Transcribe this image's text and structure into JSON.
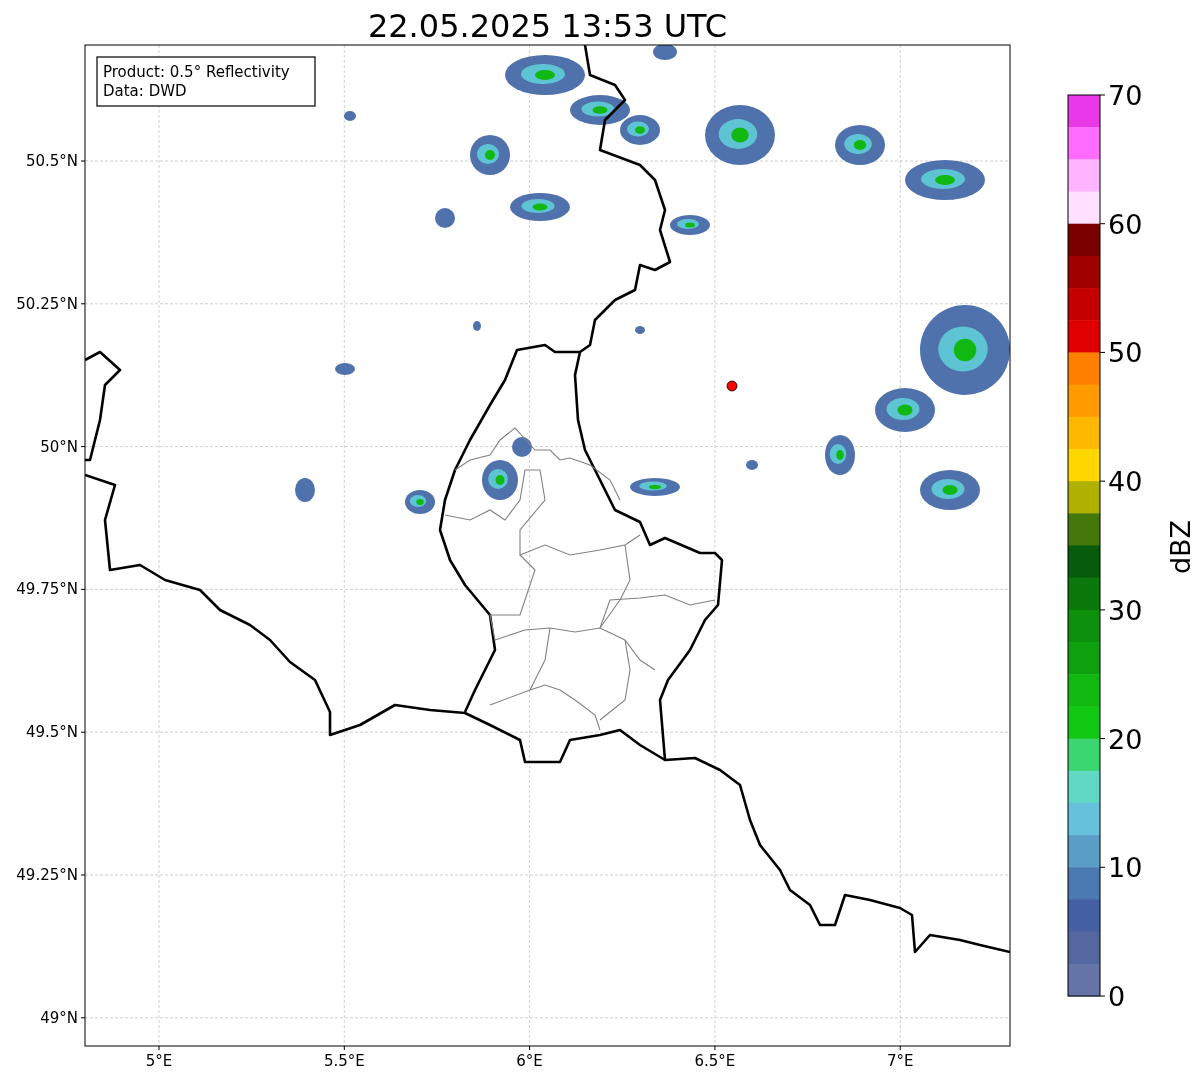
{
  "title": "22.05.2025 13:53 UTC",
  "map": {
    "info_lines": [
      "Product: 0.5° Reflectivity",
      "Data: DWD"
    ],
    "lat_ticks": [
      "50.5°N",
      "50.25°N",
      "50°N",
      "49.75°N",
      "49.5°N",
      "49.25°N",
      "49°N"
    ],
    "lon_ticks": [
      "5°E",
      "5.5°E",
      "6°E",
      "6.5°E",
      "7°E"
    ]
  },
  "colorbar": {
    "label": "dBZ",
    "ticks": [
      "70",
      "60",
      "50",
      "40",
      "30",
      "20",
      "10",
      "0"
    ],
    "bands": [
      {
        "color": "#e838e8"
      },
      {
        "color": "#ff6cff"
      },
      {
        "color": "#ffb4ff"
      },
      {
        "color": "#ffe0ff"
      },
      {
        "color": "#7a0000"
      },
      {
        "color": "#a00000"
      },
      {
        "color": "#c40000"
      },
      {
        "color": "#e00000"
      },
      {
        "color": "#ff7f00"
      },
      {
        "color": "#ff9a00"
      },
      {
        "color": "#ffb800"
      },
      {
        "color": "#ffd700"
      },
      {
        "color": "#b0b000"
      },
      {
        "color": "#44780a"
      },
      {
        "color": "#065c0a"
      },
      {
        "color": "#0a780a"
      },
      {
        "color": "#0c900c"
      },
      {
        "color": "#0ea00e"
      },
      {
        "color": "#10b810"
      },
      {
        "color": "#12c812"
      },
      {
        "color": "#3cd670"
      },
      {
        "color": "#60d8c4"
      },
      {
        "color": "#66c2dc"
      },
      {
        "color": "#5a9ec8"
      },
      {
        "color": "#4b7ab2"
      },
      {
        "color": "#4560a2"
      },
      {
        "color": "#5567a0"
      },
      {
        "color": "#6574a6"
      }
    ]
  }
}
